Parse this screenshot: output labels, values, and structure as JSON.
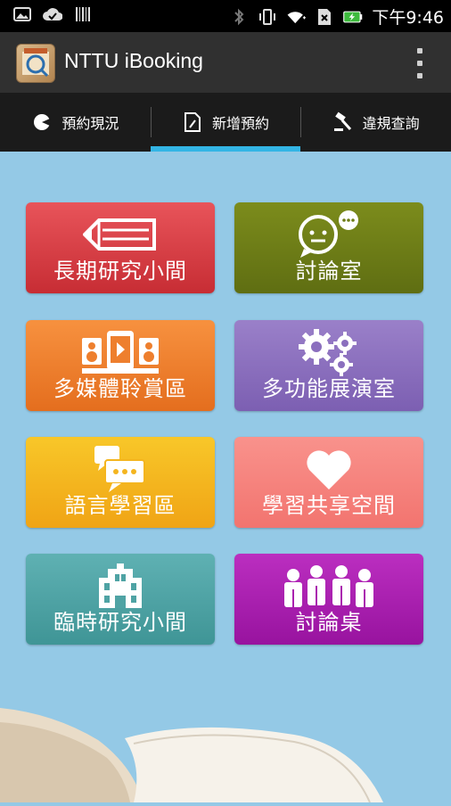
{
  "status_bar": {
    "time": "下午9:46",
    "icons": [
      "picture-icon",
      "cloud-check-icon",
      "barcode-icon",
      "bluetooth-icon",
      "vibrate-icon",
      "wifi-icon",
      "sim-icon",
      "battery-charging-icon"
    ]
  },
  "action_bar": {
    "title": "NTTU iBooking",
    "icons": [
      "app-logo-icon",
      "overflow-menu-icon"
    ]
  },
  "tabs": [
    {
      "label": "預約現況",
      "icon": "pie-chart-icon",
      "active": false
    },
    {
      "label": "新增預約",
      "icon": "document-edit-icon",
      "active": true
    },
    {
      "label": "違規查詢",
      "icon": "gavel-icon",
      "active": false
    }
  ],
  "tiles": [
    {
      "label": "長期研究小間",
      "icon": "pencil-icon",
      "color": "#d83c42"
    },
    {
      "label": "討論室",
      "icon": "chat-bubble-person-icon",
      "color": "#6e7d17"
    },
    {
      "label": "多媒體聆賞區",
      "icon": "media-player-icon",
      "color": "#ee7f2e"
    },
    {
      "label": "多功能展演室",
      "icon": "gears-icon",
      "color": "#8b6fbe"
    },
    {
      "label": "語言學習區",
      "icon": "speech-bubbles-icon",
      "color": "#f4b51f"
    },
    {
      "label": "學習共享空間",
      "icon": "heart-icon",
      "color": "#f5837e"
    },
    {
      "label": "臨時研究小間",
      "icon": "building-icon",
      "color": "#4fa3a4"
    },
    {
      "label": "討論桌",
      "icon": "group-people-icon",
      "color": "#aa21af"
    }
  ],
  "colors": {
    "background": "#94c9e6",
    "tab_indicator": "#33b5e5",
    "action_bar": "#303030"
  }
}
